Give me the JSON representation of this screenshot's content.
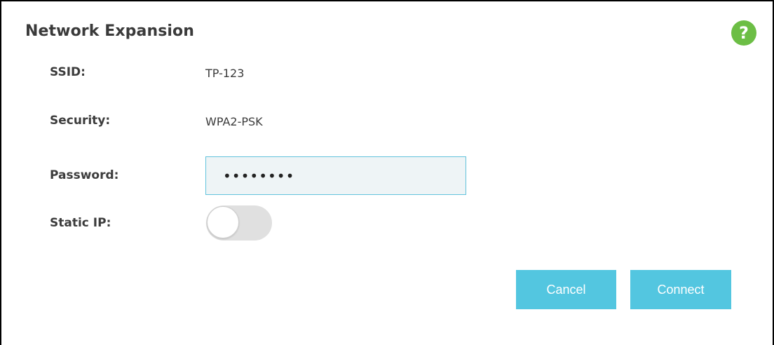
{
  "panel": {
    "title": "Network Expansion",
    "help_label": "?"
  },
  "form": {
    "ssid_label": "SSID:",
    "ssid_value": "TP-123",
    "security_label": "Security:",
    "security_value": "WPA2-PSK",
    "password_label": "Password:",
    "password_value": "••••••••",
    "static_ip_label": "Static IP:",
    "static_ip_enabled": false
  },
  "actions": {
    "cancel_label": "Cancel",
    "connect_label": "Connect"
  },
  "colors": {
    "accent": "#53c6e0",
    "help": "#6cbe45",
    "input_border": "#62c3dc",
    "toggle_off": "#e0e0e0"
  },
  "icons": {
    "help": "question-mark-icon"
  }
}
